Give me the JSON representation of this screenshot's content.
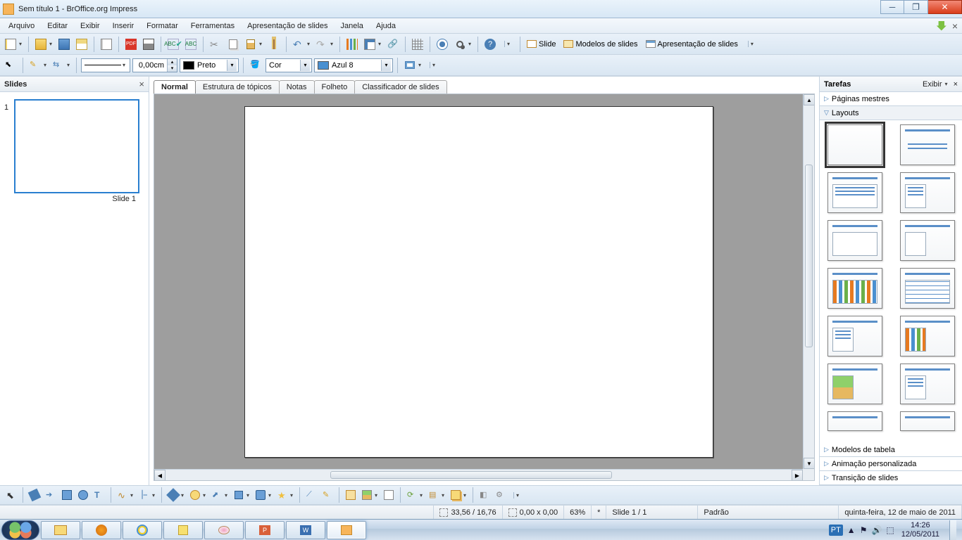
{
  "window": {
    "title": "Sem título 1 - BrOffice.org Impress"
  },
  "menu": {
    "items": [
      "Arquivo",
      "Editar",
      "Exibir",
      "Inserir",
      "Formatar",
      "Ferramentas",
      "Apresentação de slides",
      "Janela",
      "Ajuda"
    ]
  },
  "toolbar1": {
    "slide": "Slide",
    "templates": "Modelos de slides",
    "presentation": "Apresentação de slides"
  },
  "toolbar2": {
    "line_width": "0,00cm",
    "line_color": "Preto",
    "fill_mode": "Cor",
    "fill_color": "Azul 8"
  },
  "slides_panel": {
    "title": "Slides",
    "items": [
      {
        "num": "1",
        "label": "Slide 1"
      }
    ]
  },
  "view_tabs": {
    "items": [
      "Normal",
      "Estrutura de tópicos",
      "Notas",
      "Folheto",
      "Classificador de slides"
    ],
    "active": 0
  },
  "tasks_panel": {
    "title": "Tarefas",
    "view_label": "Exibir",
    "sections": {
      "masters": "Páginas mestres",
      "layouts": "Layouts",
      "table_design": "Modelos de tabela",
      "custom_anim": "Animação personalizada",
      "transition": "Transição de slides"
    }
  },
  "status": {
    "position": "33,56 / 16,76",
    "size": "0,00 x 0,00",
    "zoom": "63%",
    "modified": "*",
    "slide_count": "Slide 1 / 1",
    "template": "Padrão",
    "date_long": "quinta-feira, 12 de maio de 2011"
  },
  "taskbar": {
    "lang": "PT",
    "time": "14:26",
    "date": "12/05/2011"
  }
}
